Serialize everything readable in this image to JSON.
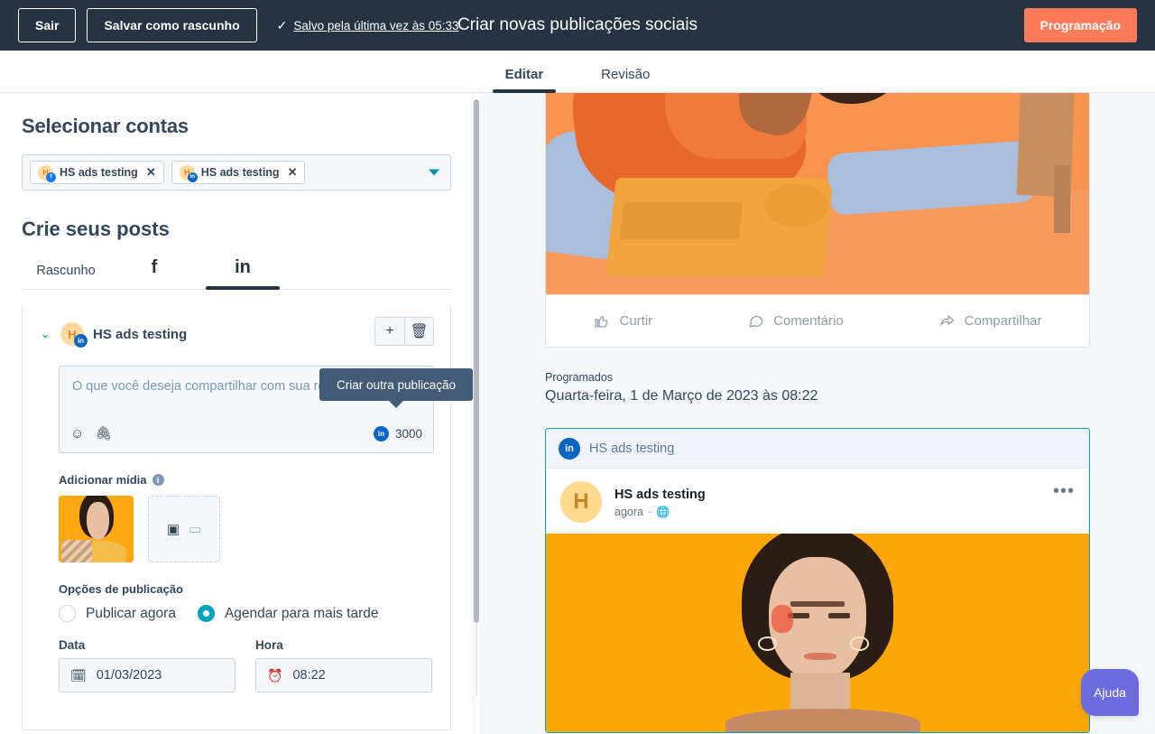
{
  "topbar": {
    "exit_label": "Sair",
    "save_draft_label": "Salvar como rascunho",
    "saved_check": "✓",
    "saved_text": "Salvo pela última vez às 05:33",
    "title": "Criar novas publicações sociais",
    "cta_label": "Programação",
    "bg_color": "#253342",
    "cta_color": "#ff7a59"
  },
  "tabs": {
    "items": [
      {
        "label": "Editar",
        "active": true
      },
      {
        "label": "Revisão",
        "active": false
      }
    ]
  },
  "left": {
    "accounts_heading": "Selecionar contas",
    "account_chips": [
      {
        "avatar_letter": "H",
        "network": "facebook",
        "network_glyph": "f",
        "label": "HS ads testing",
        "remove_glyph": "✕"
      },
      {
        "avatar_letter": "H",
        "network": "linkedin",
        "network_glyph": "in",
        "label": "HS ads testing",
        "remove_glyph": "✕"
      }
    ],
    "posts_heading": "Crie seus posts",
    "post_tabs": [
      {
        "label": "Rascunho",
        "type": "text",
        "active": false
      },
      {
        "label": "f",
        "type": "glyph",
        "name": "facebook",
        "active": false
      },
      {
        "label": "in",
        "type": "glyph",
        "name": "linkedin",
        "active": true
      }
    ],
    "tooltip_text": "Criar outra publicação",
    "editor": {
      "collapse_glyph": "⌄",
      "avatar_letter": "H",
      "network_glyph": "in",
      "account_name": "HS ads testing",
      "add_glyph": "+",
      "delete_glyph": "🗑",
      "composer_placeholder": "O que você deseja compartilhar com sua rede?",
      "emoji_glyph": "☺",
      "attach_glyph": "🖇",
      "counter_network_glyph": "in",
      "counter_value": "3000",
      "media_label": "Adicionar mídia",
      "info_glyph": "i",
      "image_icon": "▣",
      "video_icon": "▭",
      "options_label": "Opções de publicação",
      "radios": [
        {
          "label": "Publicar agora",
          "selected": false
        },
        {
          "label": "Agendar para mais tarde",
          "selected": true
        }
      ],
      "date_label": "Data",
      "date_value": "01/03/2023",
      "date_icon": "🗓",
      "time_label": "Hora",
      "time_value": "08:22",
      "time_icon": "⏰"
    }
  },
  "preview": {
    "facebook_actions": [
      {
        "label": "Curtir",
        "icon": "thumbs-up"
      },
      {
        "label": "Comentário",
        "icon": "comment-bubble"
      },
      {
        "label": "Compartilhar",
        "icon": "share-arrow"
      }
    ],
    "schedule_kicker": "Programados",
    "schedule_date": "Quarta-feira, 1 de Março de 2023 às 08:22",
    "linkedin": {
      "header_badge": "in",
      "header_name": "HS ads testing",
      "avatar_letter": "H",
      "author": "HS ads testing",
      "time": "agora",
      "separator": "·",
      "visibility_glyph": "🌐",
      "more_glyph": "•••",
      "border_color": "#00a4bd"
    }
  },
  "help": {
    "label": "Ajuda",
    "color": "#6c6ce0"
  }
}
